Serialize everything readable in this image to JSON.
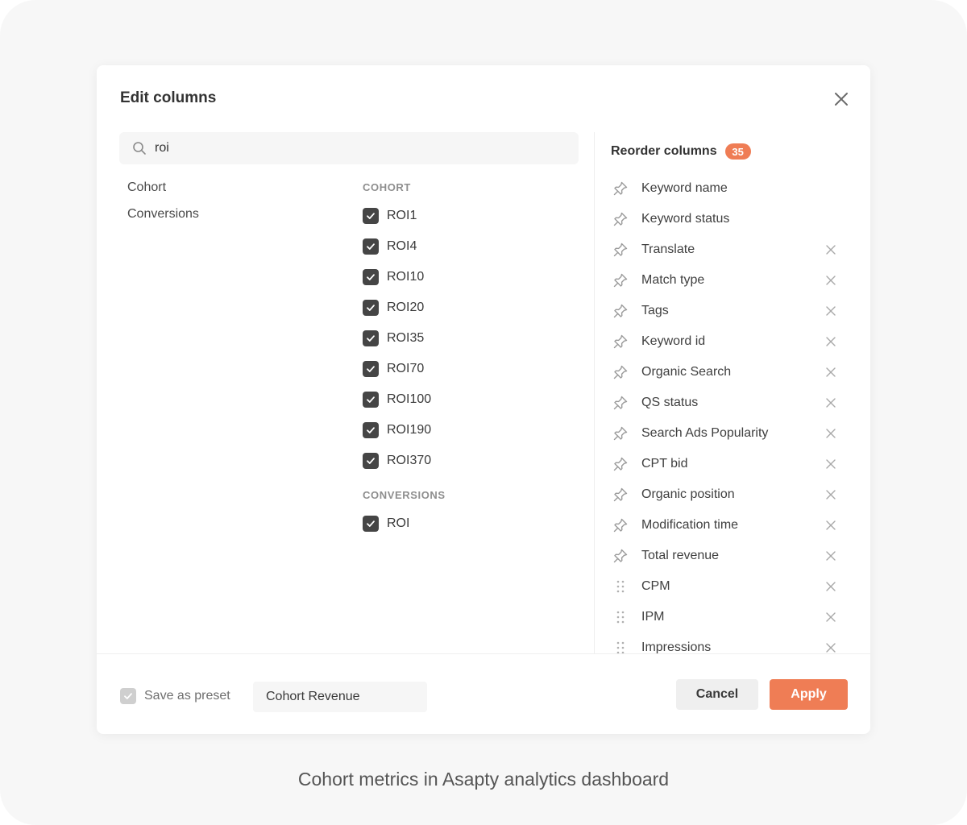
{
  "modal": {
    "title": "Edit columns",
    "search": {
      "value": "roi",
      "placeholder": ""
    },
    "categories": [
      "Cohort",
      "Conversions"
    ],
    "groups": [
      {
        "header": "COHORT",
        "items": [
          {
            "label": "ROI1",
            "checked": true
          },
          {
            "label": "ROI4",
            "checked": true
          },
          {
            "label": "ROI10",
            "checked": true
          },
          {
            "label": "ROI20",
            "checked": true
          },
          {
            "label": "ROI35",
            "checked": true
          },
          {
            "label": "ROI70",
            "checked": true
          },
          {
            "label": "ROI100",
            "checked": true
          },
          {
            "label": "ROI190",
            "checked": true
          },
          {
            "label": "ROI370",
            "checked": true
          }
        ]
      },
      {
        "header": "CONVERSIONS",
        "items": [
          {
            "label": "ROI",
            "checked": true
          }
        ]
      }
    ],
    "reorder": {
      "title": "Reorder columns",
      "count": "35",
      "items": [
        {
          "label": "Keyword name",
          "icon": "pin-icon",
          "removable": false
        },
        {
          "label": "Keyword status",
          "icon": "pin-icon",
          "removable": false
        },
        {
          "label": "Translate",
          "icon": "pin-icon",
          "removable": true
        },
        {
          "label": "Match type",
          "icon": "pin-icon",
          "removable": true
        },
        {
          "label": "Tags",
          "icon": "pin-icon",
          "removable": true
        },
        {
          "label": "Keyword id",
          "icon": "pin-icon",
          "removable": true
        },
        {
          "label": "Organic Search",
          "icon": "pin-icon",
          "removable": true
        },
        {
          "label": "QS status",
          "icon": "pin-icon",
          "removable": true
        },
        {
          "label": "Search Ads Popularity",
          "icon": "pin-icon",
          "removable": true
        },
        {
          "label": "CPT bid",
          "icon": "pin-icon",
          "removable": true
        },
        {
          "label": "Organic position",
          "icon": "pin-icon",
          "removable": true
        },
        {
          "label": "Modification time",
          "icon": "pin-icon",
          "removable": true
        },
        {
          "label": "Total revenue",
          "icon": "pin-icon",
          "removable": true
        },
        {
          "label": "CPM",
          "icon": "drag-handle-icon",
          "removable": true
        },
        {
          "label": "IPM",
          "icon": "drag-handle-icon",
          "removable": true
        },
        {
          "label": "Impressions",
          "icon": "drag-handle-icon",
          "removable": true
        }
      ]
    },
    "footer": {
      "save_preset_label": "Save as preset",
      "save_preset_checked": true,
      "preset_name": "Cohort Revenue",
      "cancel_label": "Cancel",
      "apply_label": "Apply"
    }
  },
  "caption": "Cohort metrics in Asapty analytics dashboard",
  "colors": {
    "accent": "#ef7d55",
    "checkbox": "#454545",
    "background": "#f7f7f7"
  }
}
